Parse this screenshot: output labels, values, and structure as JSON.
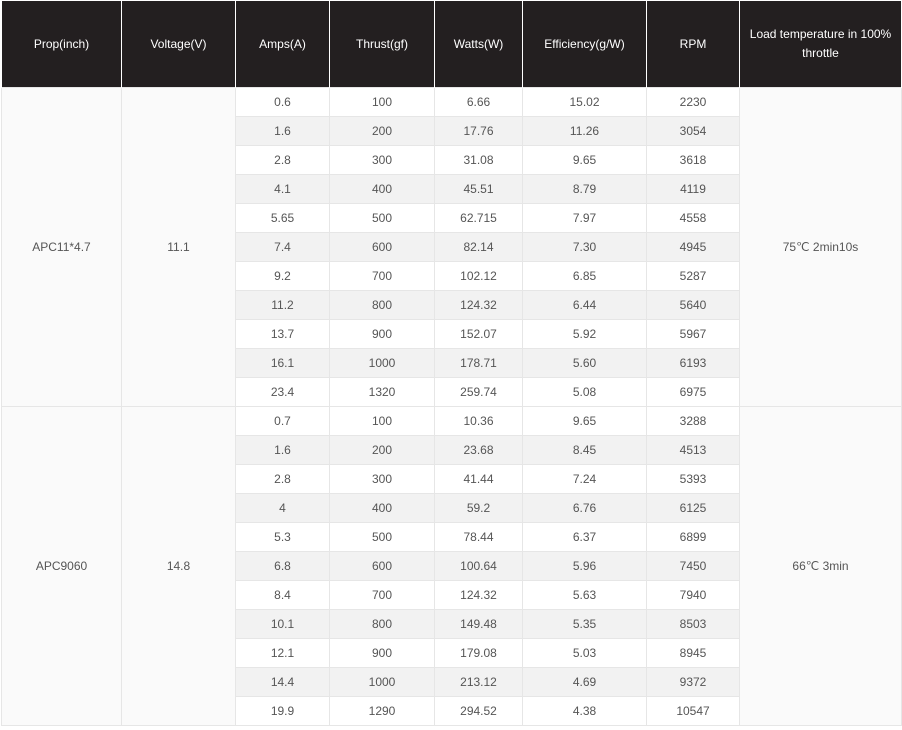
{
  "table": {
    "headers": [
      "Prop(inch)",
      "Voltage(V)",
      "Amps(A)",
      "Thrust(gf)",
      "Watts(W)",
      "Efficiency(g/W)",
      "RPM",
      "Load temperature in 100% throttle"
    ],
    "groups": [
      {
        "prop": "APC11*4.7",
        "voltage": "11.1",
        "temperature": "75℃ 2min10s",
        "rows": [
          [
            "0.6",
            "100",
            "6.66",
            "15.02",
            "2230"
          ],
          [
            "1.6",
            "200",
            "17.76",
            "11.26",
            "3054"
          ],
          [
            "2.8",
            "300",
            "31.08",
            "9.65",
            "3618"
          ],
          [
            "4.1",
            "400",
            "45.51",
            "8.79",
            "4119"
          ],
          [
            "5.65",
            "500",
            "62.715",
            "7.97",
            "4558"
          ],
          [
            "7.4",
            "600",
            "82.14",
            "7.30",
            "4945"
          ],
          [
            "9.2",
            "700",
            "102.12",
            "6.85",
            "5287"
          ],
          [
            "11.2",
            "800",
            "124.32",
            "6.44",
            "5640"
          ],
          [
            "13.7",
            "900",
            "152.07",
            "5.92",
            "5967"
          ],
          [
            "16.1",
            "1000",
            "178.71",
            "5.60",
            "6193"
          ],
          [
            "23.4",
            "1320",
            "259.74",
            "5.08",
            "6975"
          ]
        ]
      },
      {
        "prop": "APC9060",
        "voltage": "14.8",
        "temperature": "66℃ 3min",
        "rows": [
          [
            "0.7",
            "100",
            "10.36",
            "9.65",
            "3288"
          ],
          [
            "1.6",
            "200",
            "23.68",
            "8.45",
            "4513"
          ],
          [
            "2.8",
            "300",
            "41.44",
            "7.24",
            "5393"
          ],
          [
            "4",
            "400",
            "59.2",
            "6.76",
            "6125"
          ],
          [
            "5.3",
            "500",
            "78.44",
            "6.37",
            "6899"
          ],
          [
            "6.8",
            "600",
            "100.64",
            "5.96",
            "7450"
          ],
          [
            "8.4",
            "700",
            "124.32",
            "5.63",
            "7940"
          ],
          [
            "10.1",
            "800",
            "149.48",
            "5.35",
            "8503"
          ],
          [
            "12.1",
            "900",
            "179.08",
            "5.03",
            "8945"
          ],
          [
            "14.4",
            "1000",
            "213.12",
            "4.69",
            "9372"
          ],
          [
            "19.9",
            "1290",
            "294.52",
            "4.38",
            "10547"
          ]
        ]
      }
    ]
  }
}
